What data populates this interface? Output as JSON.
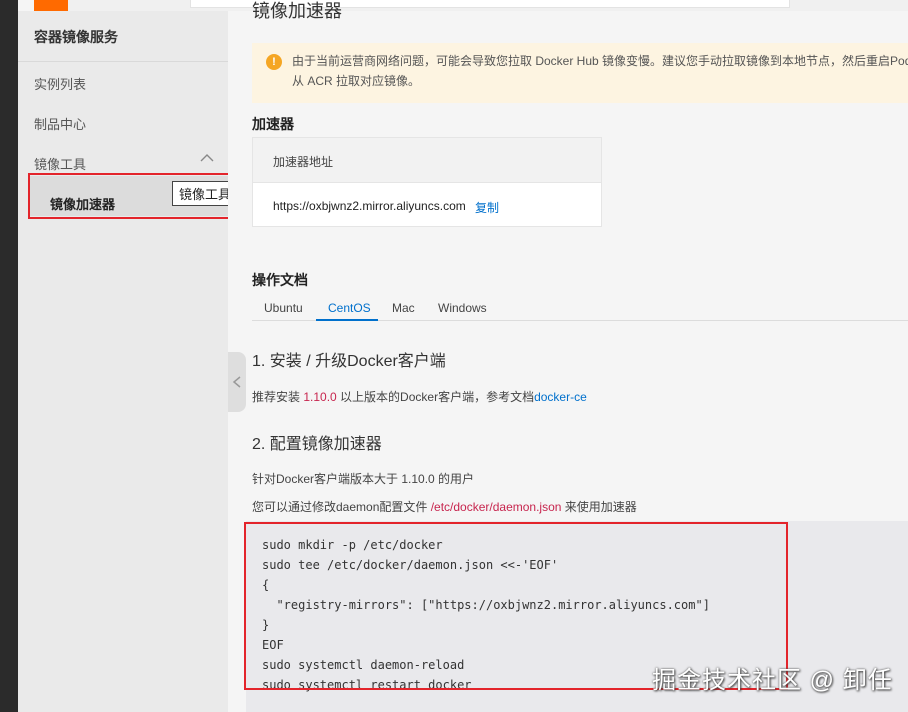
{
  "sidebar": {
    "title": "容器镜像服务",
    "items": [
      {
        "label": "实例列表"
      },
      {
        "label": "制品中心"
      },
      {
        "label": "镜像工具"
      }
    ],
    "active_item": "镜像加速器",
    "tooltip": "镜像工具"
  },
  "main": {
    "heading_clipped": "镜像加速器",
    "notice": "由于当前运营商网络问题，可能会导致您拉取 Docker Hub 镜像变慢。建议您手动拉取镜像到本地节点，然后重启Pod 从 ACR 拉取对应镜像。",
    "accelerator": {
      "section_title": "加速器",
      "column_header": "加速器地址",
      "url": "https://oxbjwnz2.mirror.aliyuncs.com",
      "copy_label": "复制"
    },
    "docs": {
      "section_title": "操作文档",
      "tabs": [
        "Ubuntu",
        "CentOS",
        "Mac",
        "Windows"
      ],
      "active_tab": "CentOS"
    },
    "step1": {
      "heading": "1. 安装 / 升级Docker客户端",
      "text_prefix": "推荐安装 ",
      "version": "1.10.0",
      "text_middle": " 以上版本的Docker客户端，参考文档",
      "link": "docker-ce"
    },
    "step2": {
      "heading": "2. 配置镜像加速器",
      "line1": "针对Docker客户端版本大于 1.10.0 的用户",
      "line2_prefix": "您可以通过修改daemon配置文件 ",
      "path": "/etc/docker/daemon.json",
      "line2_suffix": " 来使用加速器"
    },
    "code": "sudo mkdir -p /etc/docker\nsudo tee /etc/docker/daemon.json <<-'EOF'\n{\n  \"registry-mirrors\": [\"https://oxbjwnz2.mirror.aliyuncs.com\"]\n}\nEOF\nsudo systemctl daemon-reload\nsudo systemctl restart docker"
  },
  "watermark": "掘金技术社区 @ 卸任",
  "colors": {
    "accent": "#0070cc",
    "highlight_border": "#e3242b",
    "brand": "#ff6a00",
    "notice_bg": "#fdf4e1",
    "warning": "#f5a623"
  }
}
